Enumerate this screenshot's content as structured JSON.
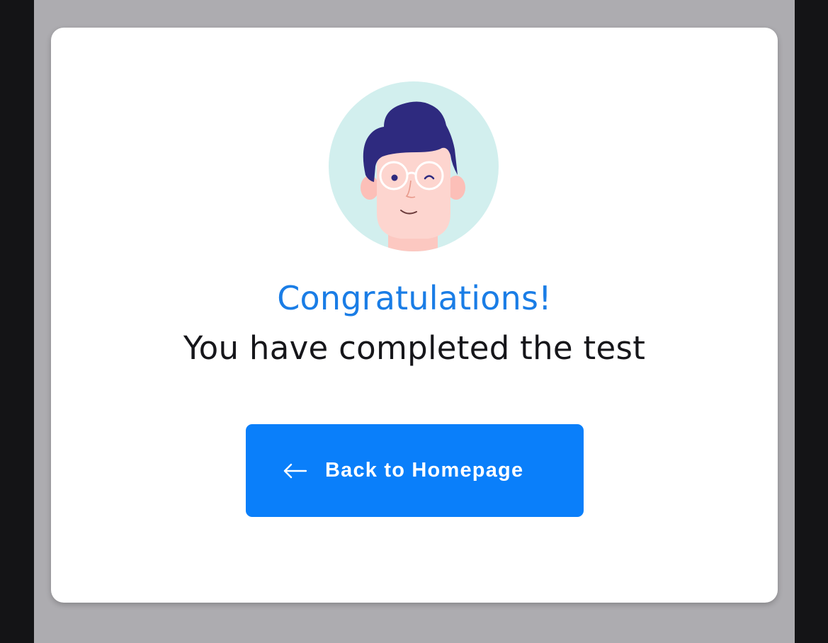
{
  "dialog": {
    "title": "Congratulations!",
    "message": "You have completed the test",
    "back_button_label": "Back to Homepage",
    "avatar_icon": "winking-man-avatar-icon",
    "back_icon": "arrow-left-icon"
  },
  "colors": {
    "outer_background": "#141416",
    "screen_background": "#adacb0",
    "card_background": "#ffffff",
    "accent": "#1a7de6",
    "button_background": "#0a7ffa",
    "avatar_background": "#d2efee",
    "hair": "#2e2a7f",
    "skin": "#fdd1cb"
  }
}
